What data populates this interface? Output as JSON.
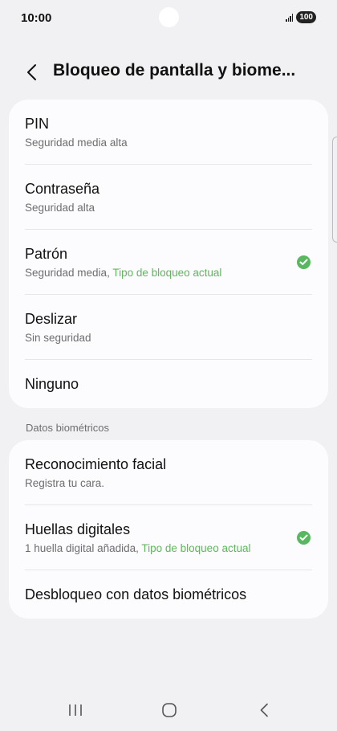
{
  "status": {
    "time": "10:00",
    "battery": "100",
    "icons": [
      "signal-icon",
      "battery-icon"
    ]
  },
  "header": {
    "title": "Bloqueo de pantalla y biome..."
  },
  "lock_options": [
    {
      "title": "PIN",
      "subtitle": "Seguridad media alta",
      "accent": "",
      "selected": false
    },
    {
      "title": "Contraseña",
      "subtitle": "Seguridad alta",
      "accent": "",
      "selected": false
    },
    {
      "title": "Patrón",
      "subtitle": "Seguridad media, ",
      "accent": "Tipo de bloqueo actual",
      "selected": true
    },
    {
      "title": "Deslizar",
      "subtitle": "Sin seguridad",
      "accent": "",
      "selected": false
    },
    {
      "title": "Ninguno",
      "subtitle": "",
      "accent": "",
      "selected": false
    }
  ],
  "biometrics": {
    "section_label": "Datos biométricos",
    "items": [
      {
        "title": "Reconocimiento facial",
        "subtitle": "Registra tu cara.",
        "accent": "",
        "selected": false
      },
      {
        "title": "Huellas digitales",
        "subtitle": "1 huella digital añadida, ",
        "accent": "Tipo de bloqueo actual",
        "selected": true
      },
      {
        "title": "Desbloqueo con datos biométricos",
        "subtitle": "",
        "accent": "",
        "selected": false
      }
    ]
  },
  "colors": {
    "accent": "#5fb65c",
    "check": "#58b85d",
    "background": "#f1f1f3",
    "card": "#fcfcfe"
  }
}
